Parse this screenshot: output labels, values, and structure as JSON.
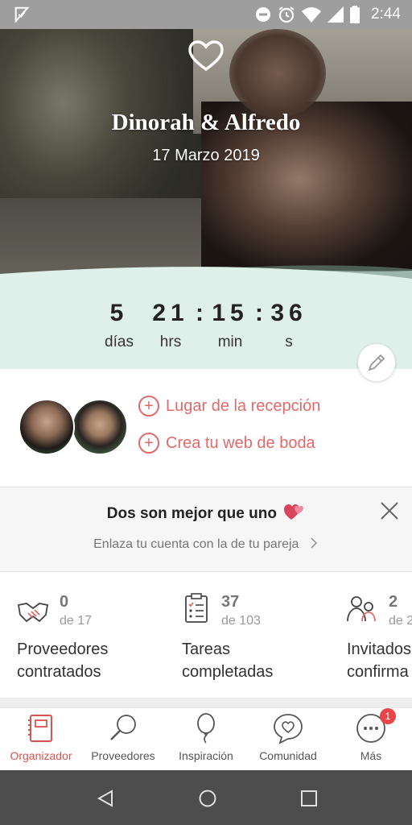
{
  "status_bar": {
    "time": "2:44"
  },
  "hero": {
    "couple_names": "Dinorah & Alfredo",
    "date": "17 Marzo 2019"
  },
  "countdown": {
    "days": "5",
    "days_label": "días",
    "hours": "21",
    "hours_label": "hrs",
    "minutes": "15",
    "minutes_label": "min",
    "seconds": "36",
    "seconds_label": "s"
  },
  "couple_links": {
    "reception": "Lugar de la recepción",
    "website": "Crea tu web de boda"
  },
  "partner_banner": {
    "title": "Dos son mejor que uno",
    "subtitle": "Enlaza tu cuenta con la de tu pareja"
  },
  "stats": [
    {
      "value": "0",
      "of": "de 17",
      "label_1": "Proveedores",
      "label_2": "contratados",
      "icon": "handshake-icon"
    },
    {
      "value": "37",
      "of": "de 103",
      "label_1": "Tareas",
      "label_2": "completadas",
      "icon": "checklist-icon"
    },
    {
      "value": "2",
      "of": "de 2",
      "label_1": "Invitados",
      "label_2": "confirma",
      "icon": "guests-icon"
    }
  ],
  "bottom_nav": {
    "items": [
      {
        "label": "Organizador",
        "icon": "notebook-icon",
        "active": true
      },
      {
        "label": "Proveedores",
        "icon": "magnifier-icon",
        "active": false
      },
      {
        "label": "Inspiración",
        "icon": "balloon-icon",
        "active": false
      },
      {
        "label": "Comunidad",
        "icon": "chat-heart-icon",
        "active": false
      },
      {
        "label": "Más",
        "icon": "more-icon",
        "active": false
      }
    ],
    "badge": "1"
  },
  "colors": {
    "accent": "#e06a6a",
    "countdown_bg": "#dff0ea",
    "nav_active": "#d9534f",
    "badge": "#e8454a"
  }
}
